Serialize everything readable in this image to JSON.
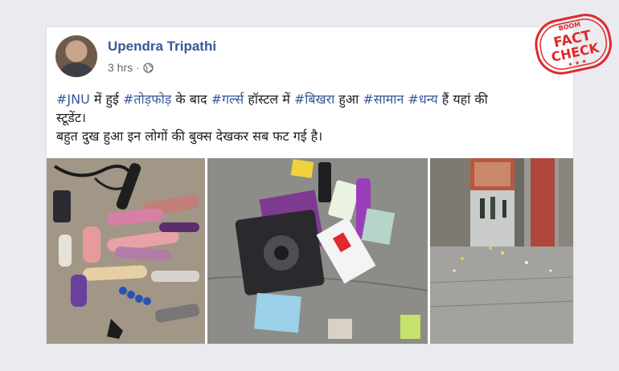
{
  "post": {
    "author": "Upendra Tripathi",
    "time": "3 hrs",
    "separator": "·",
    "privacy_icon": "globe-icon",
    "lines": [
      [
        {
          "text": "#JNU",
          "tag": true
        },
        {
          "text": " में हुई ",
          "tag": false
        },
        {
          "text": "#तोड़फोड़",
          "tag": true
        },
        {
          "text": " के बाद ",
          "tag": false
        },
        {
          "text": "#गर्ल्स",
          "tag": true
        },
        {
          "text": " हॉस्टल में ",
          "tag": false
        },
        {
          "text": "#बिखरा",
          "tag": true
        },
        {
          "text": " हुआ ",
          "tag": false
        },
        {
          "text": "#सामान",
          "tag": true
        },
        {
          "text": " ",
          "tag": false
        },
        {
          "text": "#धन्य",
          "tag": true
        },
        {
          "text": " हैं यहां की",
          "tag": false
        }
      ],
      [
        {
          "text": "स्टूडेंट।",
          "tag": false
        }
      ],
      [
        {
          "text": "बहुत दुख हुआ इन लोगों की बुक्स देखकर सब फट गई है।",
          "tag": false
        }
      ]
    ]
  },
  "stamp": {
    "top": "BOOM",
    "word1": "FACT",
    "word2": "CHECK",
    "color": "#e0282d"
  },
  "colors": {
    "link": "#385898",
    "author": "#365899",
    "meta": "#616770",
    "text": "#1c1e21"
  }
}
